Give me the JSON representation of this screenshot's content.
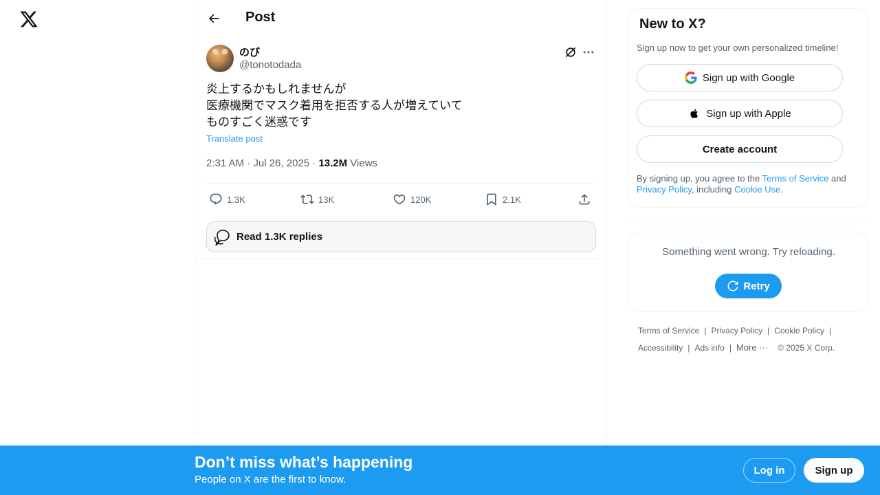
{
  "nav": {
    "logo_icon": "x-logo-icon"
  },
  "header": {
    "title": "Post",
    "back_icon": "back-arrow-icon"
  },
  "tweet": {
    "display_name": "のび",
    "handle": "@tonotodada",
    "text_lines": [
      "炎上するかもしれませんが",
      "医療機関でマスク着用を拒否する人が増えていて",
      "ものすごく迷惑です"
    ],
    "translate_label": "Translate post",
    "time": "2:31 AM · Jul 26, 2025 · ",
    "views_count": "13.2M",
    "views_label": " Views",
    "actions": {
      "replies": "1.3K",
      "reposts": "13K",
      "likes": "120K",
      "bookmarks": "2.1K"
    },
    "read_replies_label": "Read 1.3K replies"
  },
  "sidebar": {
    "new_to_x": {
      "title": "New to X?",
      "subtitle": "Sign up now to get your own personalized timeline!",
      "google_label": "Sign up with Google",
      "apple_label": "Sign up with Apple",
      "create_label": "Create account",
      "terms_prefix": "By signing up, you agree to the ",
      "terms_link": "Terms of Service",
      "terms_and": " and ",
      "privacy_link": "Privacy Policy",
      "terms_including": ", including ",
      "cookie_link": "Cookie Use",
      "terms_end": "."
    },
    "error": {
      "message": "Something went wrong. Try reloading.",
      "retry_label": "Retry"
    },
    "footer": {
      "terms": "Terms of Service",
      "privacy": "Privacy Policy",
      "cookie": "Cookie Policy",
      "accessibility": "Accessibility",
      "ads": "Ads info",
      "more": "More ···",
      "copyright": "© 2025 X Corp."
    }
  },
  "banner": {
    "title": "Don’t miss what’s happening",
    "subtitle": "People on X are the first to know.",
    "login_label": "Log in",
    "signup_label": "Sign up"
  },
  "colors": {
    "accent": "#1d9bf0",
    "text": "#0f1419",
    "secondary": "#536471",
    "border": "#eff3f4"
  }
}
